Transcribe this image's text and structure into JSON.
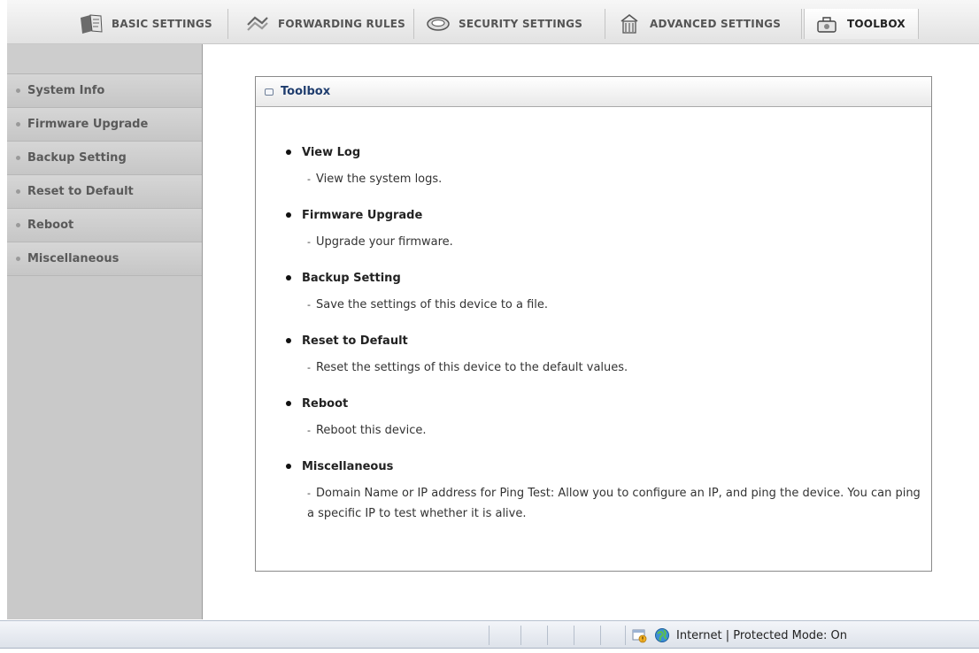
{
  "topnav": {
    "tabs": [
      {
        "label": "BASIC SETTINGS",
        "icon": "notebook-icon"
      },
      {
        "label": "FORWARDING RULES",
        "icon": "network-arrows-icon"
      },
      {
        "label": "SECURITY SETTINGS",
        "icon": "shield-disk-icon"
      },
      {
        "label": "ADVANCED SETTINGS",
        "icon": "building-icon"
      },
      {
        "label": "TOOLBOX",
        "icon": "toolbox-icon",
        "active": true
      }
    ]
  },
  "sidebar": {
    "items": [
      {
        "label": "System Info"
      },
      {
        "label": "Firmware Upgrade"
      },
      {
        "label": "Backup Setting"
      },
      {
        "label": "Reset to Default"
      },
      {
        "label": "Reboot"
      },
      {
        "label": "Miscellaneous"
      }
    ]
  },
  "panel": {
    "title": "Toolbox",
    "entries": [
      {
        "title": "View Log",
        "desc": "View the system logs."
      },
      {
        "title": "Firmware Upgrade",
        "desc": "Upgrade your firmware."
      },
      {
        "title": "Backup Setting",
        "desc": "Save the settings of this device to a file."
      },
      {
        "title": "Reset to Default",
        "desc": "Reset the settings of this device to the default values."
      },
      {
        "title": "Reboot",
        "desc": "Reboot this device."
      },
      {
        "title": "Miscellaneous",
        "desc": "Domain Name or IP address for Ping Test: Allow you to configure an IP, and ping the device. You can ping a specific IP to test whether it is alive."
      }
    ]
  },
  "statusbar": {
    "zone_text": "Internet | Protected Mode: On",
    "icons": [
      "security-warning-icon",
      "globe-icon"
    ]
  },
  "colors": {
    "panel_title": "#1f3d6e",
    "sidebar_bg": "#c9c9c9"
  }
}
